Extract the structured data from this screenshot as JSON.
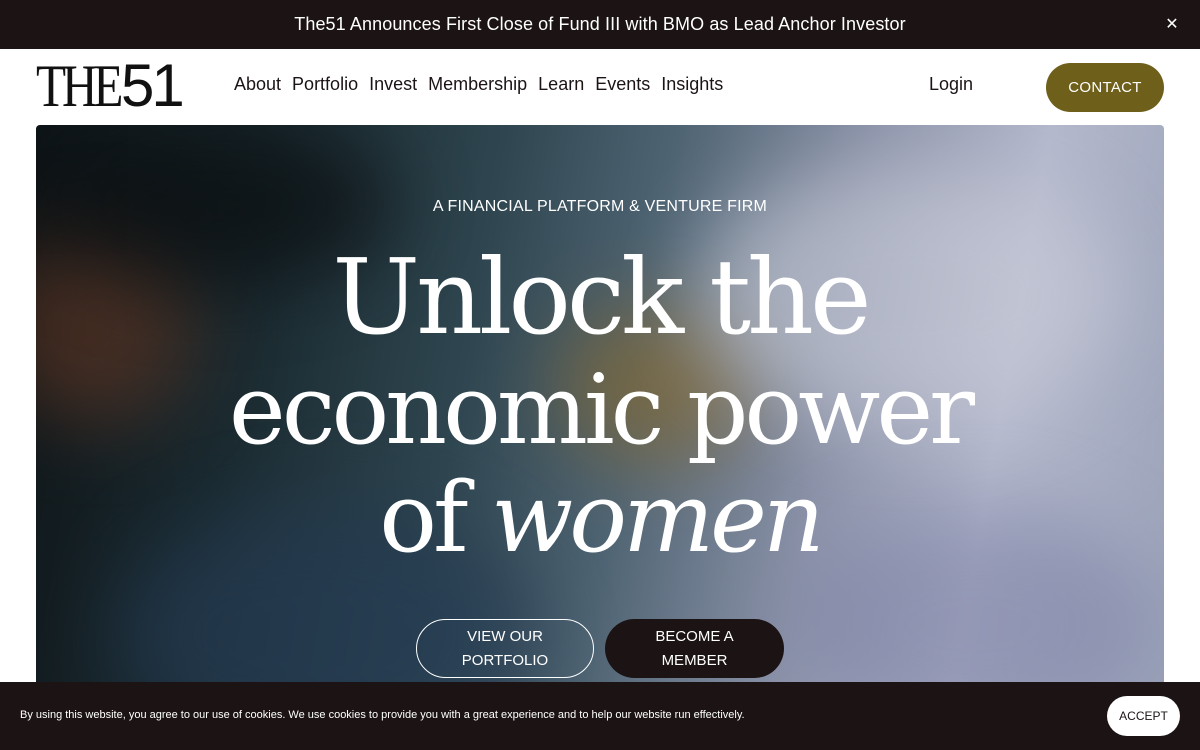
{
  "announcement": {
    "text": "The51 Announces First Close of Fund III with BMO as Lead Anchor Investor",
    "close_icon": "close-icon"
  },
  "brand": {
    "logo_prefix": "THE",
    "logo_number": "51"
  },
  "nav": {
    "items": [
      "About",
      "Portfolio",
      "Invest",
      "Membership",
      "Learn",
      "Events",
      "Insights"
    ],
    "login": "Login",
    "contact": "CONTACT"
  },
  "hero": {
    "eyebrow": "A FINANCIAL PLATFORM & VENTURE FIRM",
    "line1": "Unlock the",
    "line2": "economic power",
    "line3_prefix": "of ",
    "line3_emphasis": "women",
    "primary_cta_line1": "VIEW OUR",
    "primary_cta_line2": "PORTFOLIO",
    "secondary_cta_line1": "BECOME A",
    "secondary_cta_line2": "MEMBER"
  },
  "cookie": {
    "text": "By using this website, you agree to our use of cookies. We use cookies to provide you with a great experience and to help our website run effectively.",
    "accept": "ACCEPT"
  },
  "colors": {
    "dark": "#1c1414",
    "accent": "#6e5f1b",
    "white": "#ffffff"
  }
}
